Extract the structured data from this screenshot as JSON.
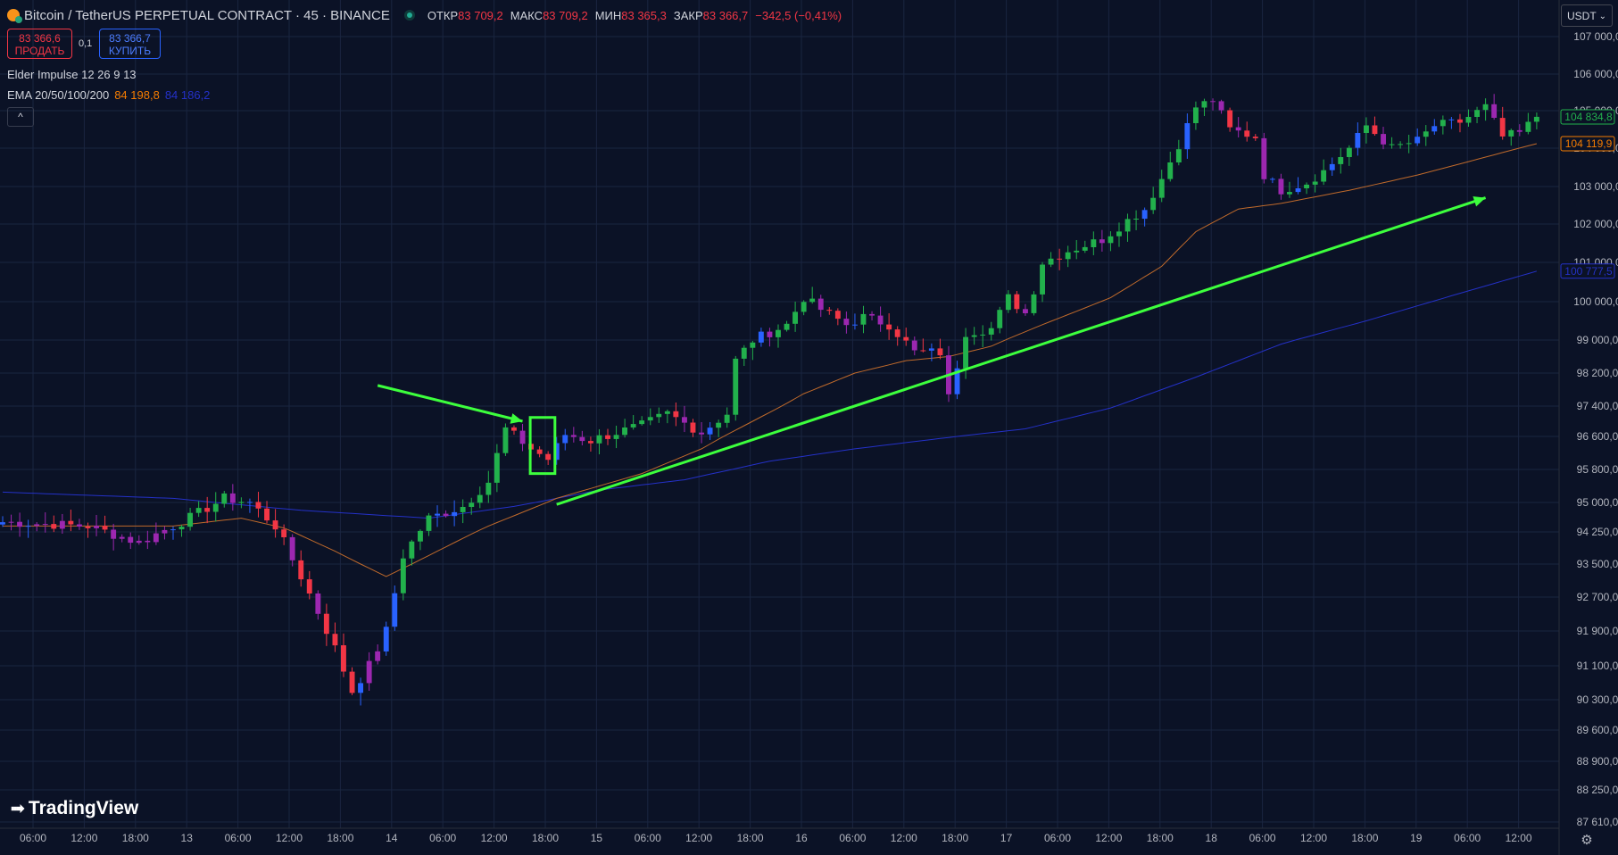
{
  "header": {
    "symbol": "Bitcoin / TetherUS PERPETUAL CONTRACT · 45 · BINANCE",
    "open_label": "ОТКР",
    "open": "83 709,2",
    "high_label": "МАКС",
    "high": "83 709,2",
    "low_label": "МИН",
    "low": "83 365,3",
    "close_label": "ЗАКР",
    "close": "83 366,7",
    "change": "−342,5 (−0,41%)"
  },
  "trade": {
    "sell_price": "83 366,6",
    "sell_label": "ПРОДАТЬ",
    "spread": "0,1",
    "buy_price": "83 366,7",
    "buy_label": "КУПИТЬ"
  },
  "indicators": {
    "elder": "Elder Impulse 12 26 9 13",
    "ema_label": "EMA 20/50/100/200",
    "ema_value_1": "84 198,8",
    "ema_value_2": "84 186,2"
  },
  "collapse_label": "^",
  "currency": "USDT",
  "logo_text": "TradingView",
  "colors": {
    "background": "#0b1226",
    "bull": "#22b14c",
    "bear": "#f23645",
    "impulse_neutral": "#2962ff",
    "impulse_purple": "#9c27b0",
    "ema_fast": "#c06a2b",
    "ema_slow": "#2431c8",
    "annotation": "#3dff3d"
  },
  "chart_data": {
    "type": "candlestick",
    "ylim": [
      87610,
      107000
    ],
    "y_ticks": [
      "107 000,0",
      "106 000,0",
      "105 000,0",
      "104 000,0",
      "103 000,0",
      "102 000,0",
      "101 000,0",
      "100 000,0",
      "99 000,0",
      "98 200,0",
      "97 400,0",
      "96 600,0",
      "95 800,0",
      "95 000,0",
      "94 250,0",
      "93 500,0",
      "92 700,0",
      "91 900,0",
      "91 100,0",
      "90 300,0",
      "89 600,0",
      "88 900,0",
      "88 250,0",
      "87 610,0"
    ],
    "x_ticks": [
      "06:00",
      "12:00",
      "18:00",
      "13",
      "06:00",
      "12:00",
      "18:00",
      "14",
      "06:00",
      "12:00",
      "18:00",
      "15",
      "06:00",
      "12:00",
      "18:00",
      "16",
      "06:00",
      "12:00",
      "18:00",
      "17",
      "06:00",
      "12:00",
      "18:00",
      "18",
      "06:00",
      "12:00",
      "18:00",
      "19",
      "06:00",
      "12:00"
    ],
    "price_labels": [
      {
        "text": "104 834,8",
        "value": 104834.8,
        "color": "#22b14c"
      },
      {
        "text": "104 119,9",
        "value": 104119.9,
        "color": "#f57c00"
      },
      {
        "text": "100 777,5",
        "value": 100777.5,
        "color": "#2431c8"
      }
    ],
    "keypoints": [
      [
        0,
        94500
      ],
      [
        10,
        94400
      ],
      [
        16,
        94000
      ],
      [
        21,
        94500
      ],
      [
        26,
        95100
      ],
      [
        29,
        95000
      ],
      [
        32,
        94400
      ],
      [
        35,
        93200
      ],
      [
        39,
        91500
      ],
      [
        41,
        90500
      ],
      [
        43,
        91100
      ],
      [
        45,
        91900
      ],
      [
        47,
        93700
      ],
      [
        50,
        94600
      ],
      [
        54,
        94900
      ],
      [
        57,
        95500
      ],
      [
        59,
        96800
      ],
      [
        62,
        96300
      ],
      [
        64,
        96050
      ],
      [
        66,
        96650
      ],
      [
        69,
        96500
      ],
      [
        72,
        96700
      ],
      [
        75,
        96900
      ],
      [
        78,
        97200
      ],
      [
        82,
        96700
      ],
      [
        85,
        97200
      ],
      [
        86,
        98500
      ],
      [
        88,
        99000
      ],
      [
        92,
        99400
      ],
      [
        94,
        100100
      ],
      [
        96,
        99800
      ],
      [
        99,
        99400
      ],
      [
        101,
        99600
      ],
      [
        104,
        99400
      ],
      [
        107,
        98700
      ],
      [
        110,
        98700
      ],
      [
        111,
        97600
      ],
      [
        113,
        99200
      ],
      [
        116,
        99300
      ],
      [
        118,
        100100
      ],
      [
        120,
        99700
      ],
      [
        121,
        100300
      ],
      [
        122,
        101000
      ],
      [
        125,
        101300
      ],
      [
        129,
        101600
      ],
      [
        132,
        102100
      ],
      [
        134,
        102400
      ],
      [
        136,
        103200
      ],
      [
        138,
        104100
      ],
      [
        140,
        105100
      ],
      [
        142,
        105300
      ],
      [
        144,
        104500
      ],
      [
        147,
        104300
      ],
      [
        148,
        103300
      ],
      [
        150,
        102900
      ],
      [
        153,
        103100
      ],
      [
        155,
        103400
      ],
      [
        158,
        104000
      ],
      [
        160,
        104600
      ],
      [
        163,
        104000
      ],
      [
        166,
        104200
      ],
      [
        168,
        104600
      ],
      [
        171,
        104700
      ],
      [
        174,
        105100
      ],
      [
        176,
        104300
      ],
      [
        178,
        104400
      ],
      [
        180,
        104834.8
      ]
    ],
    "ema_fast_points": [
      [
        0,
        94400
      ],
      [
        20,
        94400
      ],
      [
        28,
        94600
      ],
      [
        33,
        94350
      ],
      [
        39,
        93800
      ],
      [
        45,
        93200
      ],
      [
        50,
        93700
      ],
      [
        57,
        94400
      ],
      [
        65,
        95100
      ],
      [
        75,
        95700
      ],
      [
        82,
        96300
      ],
      [
        88,
        97000
      ],
      [
        94,
        97700
      ],
      [
        100,
        98200
      ],
      [
        106,
        98500
      ],
      [
        111,
        98600
      ],
      [
        116,
        98850
      ],
      [
        122,
        99400
      ],
      [
        130,
        100100
      ],
      [
        136,
        100900
      ],
      [
        140,
        101800
      ],
      [
        145,
        102400
      ],
      [
        150,
        102550
      ],
      [
        158,
        102900
      ],
      [
        166,
        103300
      ],
      [
        172,
        103650
      ],
      [
        180,
        104119.9
      ]
    ],
    "ema_slow_points": [
      [
        0,
        95250
      ],
      [
        20,
        95100
      ],
      [
        35,
        94800
      ],
      [
        50,
        94600
      ],
      [
        60,
        94900
      ],
      [
        70,
        95300
      ],
      [
        80,
        95550
      ],
      [
        90,
        96000
      ],
      [
        100,
        96300
      ],
      [
        110,
        96550
      ],
      [
        120,
        96800
      ],
      [
        130,
        97350
      ],
      [
        140,
        98100
      ],
      [
        150,
        98900
      ],
      [
        160,
        99500
      ],
      [
        170,
        100150
      ],
      [
        180,
        100777.5
      ]
    ],
    "annotations": [
      {
        "type": "arrow",
        "from": [
          44,
          97900
        ],
        "to": [
          61,
          97000
        ]
      },
      {
        "type": "box",
        "from": [
          61.9,
          97100
        ],
        "to": [
          64.8,
          95700
        ]
      },
      {
        "type": "arrow",
        "from": [
          65,
          94950
        ],
        "to": [
          174,
          102700
        ]
      }
    ]
  }
}
